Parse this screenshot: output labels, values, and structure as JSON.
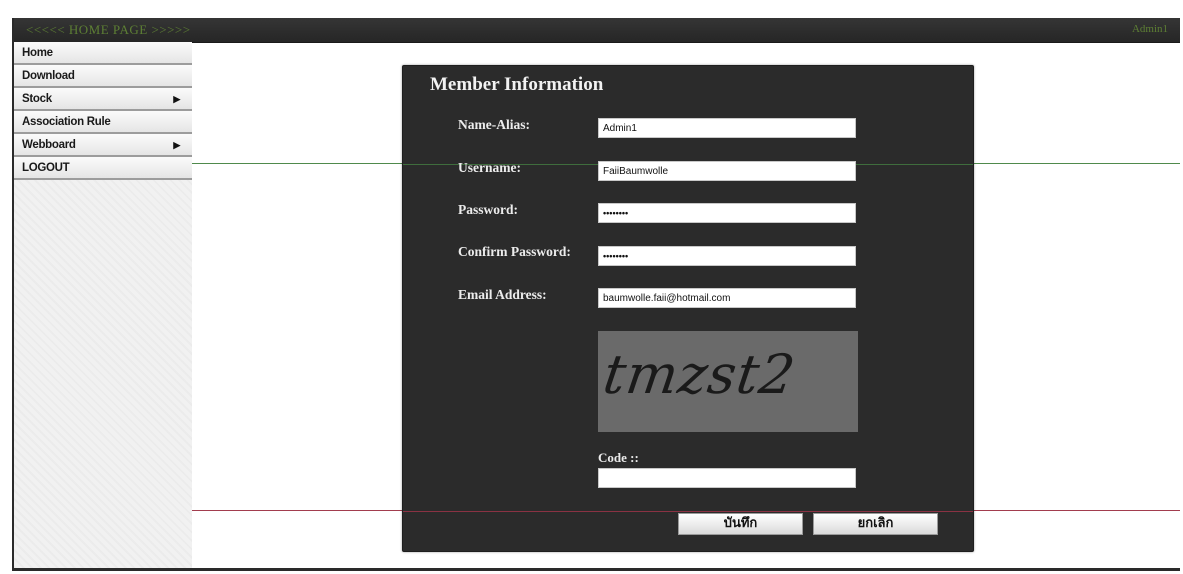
{
  "topbar": {
    "title": "<<<<< HOME PAGE >>>>>",
    "user": "Admin1"
  },
  "sidebar": {
    "items": [
      {
        "label": "Home",
        "arrow": ""
      },
      {
        "label": "Download",
        "arrow": ""
      },
      {
        "label": "Stock",
        "arrow": "▶"
      },
      {
        "label": "Association Rule",
        "arrow": ""
      },
      {
        "label": "Webboard",
        "arrow": "▶"
      },
      {
        "label": "LOGOUT",
        "arrow": ""
      }
    ]
  },
  "form": {
    "title": "Member Information",
    "fields": {
      "name_alias": {
        "label": "Name-Alias:",
        "value": "Admin1"
      },
      "username": {
        "label": "Username:",
        "value": "FaiiBaumwolle"
      },
      "password": {
        "label": "Password:",
        "value": "••••••••"
      },
      "confirm_password": {
        "label": "Confirm Password:",
        "value": "••••••••"
      },
      "email": {
        "label": "Email Address:",
        "value": "baumwolle.faii@hotmail.com"
      }
    },
    "captcha": {
      "text": "tmzst2"
    },
    "code": {
      "label": "Code ::",
      "value": ""
    },
    "buttons": {
      "save": "บันทึก",
      "cancel": "ยกเลิก"
    }
  },
  "colors": {
    "topbar": "#2b2b2b",
    "panel": "#2b2b2b",
    "title_green": "#5d7f34",
    "divider_green": "#4f8a4c",
    "divider_red": "#a23d4e"
  },
  "icons": {
    "submenu": "chevron-right-icon"
  }
}
